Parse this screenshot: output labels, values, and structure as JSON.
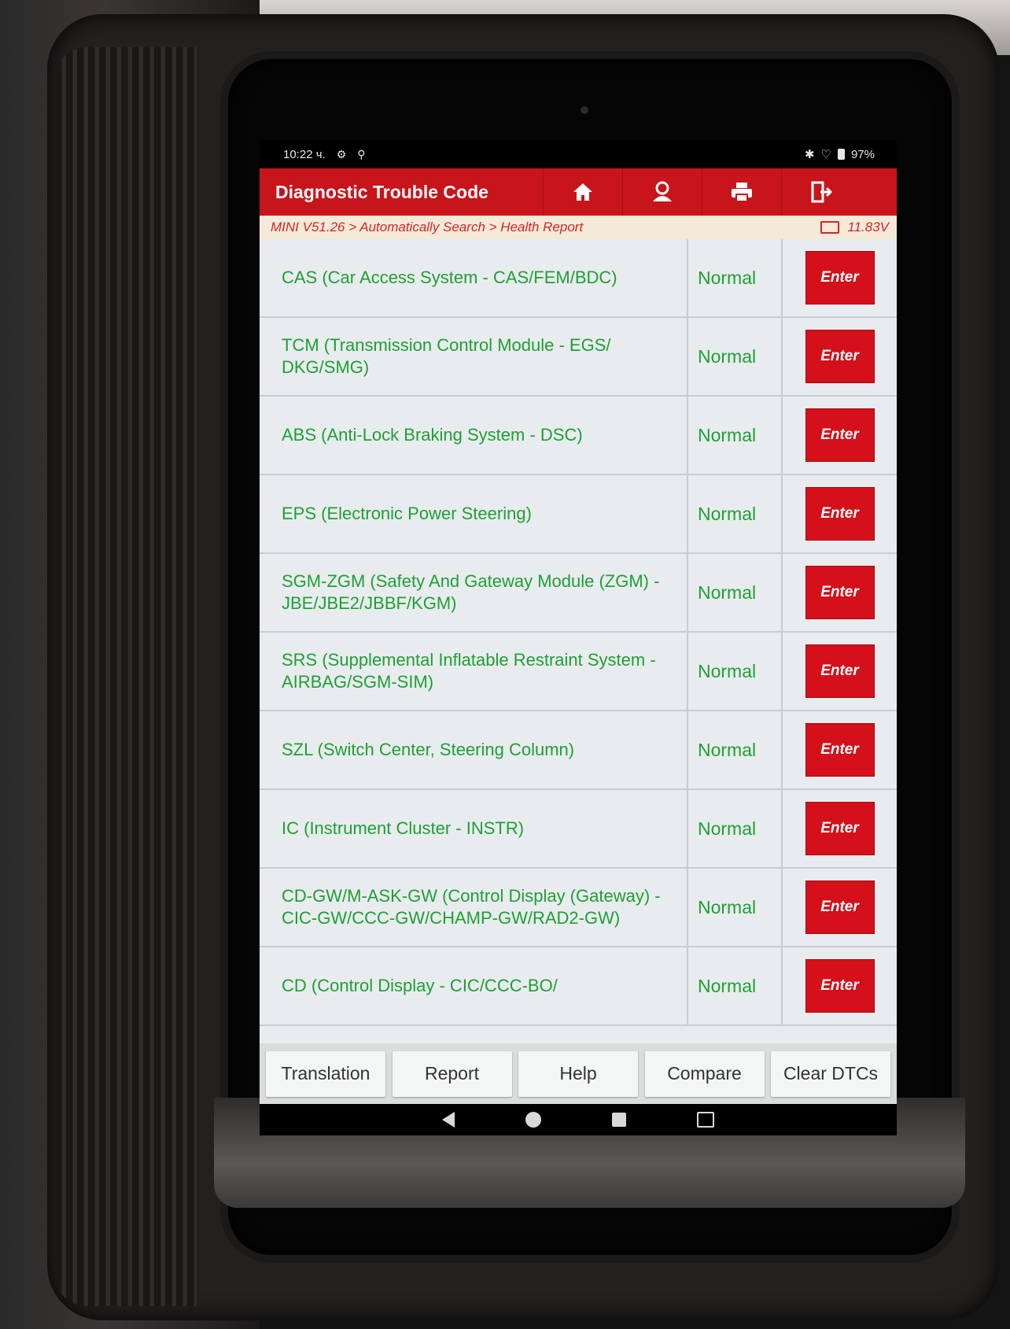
{
  "status_bar": {
    "time": "10:22 ч.",
    "battery": "97%"
  },
  "header": {
    "title": "Diagnostic Trouble Code",
    "icons": [
      "home-icon",
      "user-icon",
      "print-icon",
      "exit-icon"
    ]
  },
  "breadcrumb": {
    "path": "MINI V51.26 > Automatically Search > Health Report",
    "voltage": "11.83V"
  },
  "systems": [
    {
      "name": "CAS (Car Access System - CAS/FEM/BDC)",
      "status": "Normal",
      "action": "Enter"
    },
    {
      "name": "TCM (Transmission Control Module - EGS/ DKG/SMG)",
      "status": "Normal",
      "action": "Enter"
    },
    {
      "name": "ABS (Anti-Lock Braking System - DSC)",
      "status": "Normal",
      "action": "Enter"
    },
    {
      "name": "EPS (Electronic Power Steering)",
      "status": "Normal",
      "action": "Enter"
    },
    {
      "name": "SGM-ZGM (Safety And Gateway Module (ZGM) - JBE/JBE2/JBBF/KGM)",
      "status": "Normal",
      "action": "Enter"
    },
    {
      "name": "SRS (Supplemental Inflatable Restraint System - AIRBAG/SGM-SIM)",
      "status": "Normal",
      "action": "Enter"
    },
    {
      "name": "SZL (Switch Center, Steering Column)",
      "status": "Normal",
      "action": "Enter"
    },
    {
      "name": "IC (Instrument Cluster - INSTR)",
      "status": "Normal",
      "action": "Enter"
    },
    {
      "name": "CD-GW/M-ASK-GW (Control Display (Gateway) - CIC-GW/CCC-GW/CHAMP-GW/RAD2-GW)",
      "status": "Normal",
      "action": "Enter"
    },
    {
      "name": "CD (Control Display - CIC/CCC-BO/",
      "status": "Normal",
      "action": "Enter"
    }
  ],
  "bottom_buttons": {
    "translation": "Translation",
    "report": "Report",
    "help": "Help",
    "compare": "Compare",
    "clear": "Clear DTCs"
  },
  "colors": {
    "accent": "#c8141b",
    "ok_text": "#1ea035",
    "list_bg": "#e9ecee"
  }
}
